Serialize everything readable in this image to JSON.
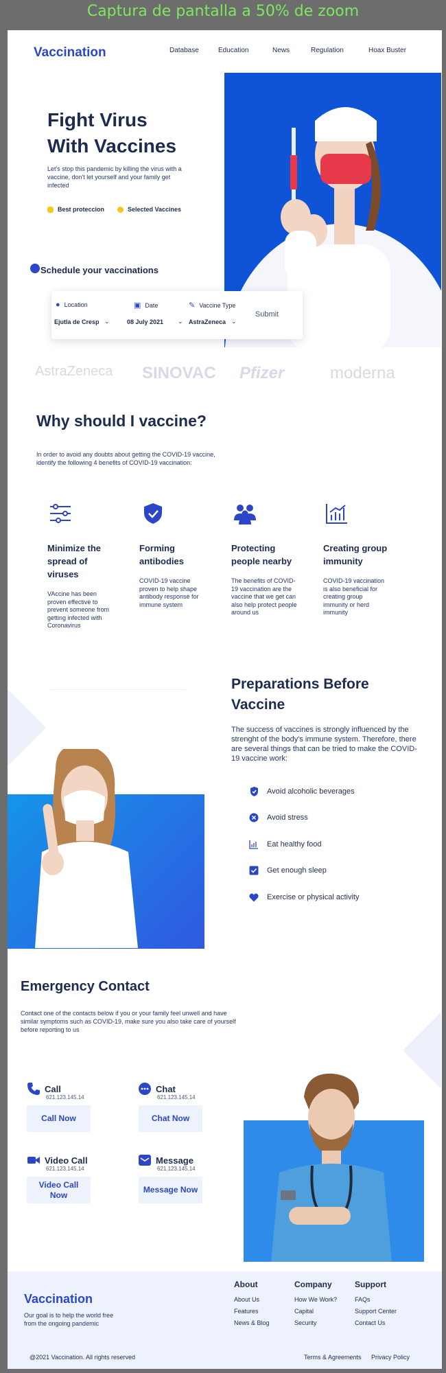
{
  "caption": "Captura de pantalla a 50% de zoom",
  "nav": {
    "logo": "Vaccination",
    "links": [
      "Database",
      "Education",
      "News",
      "Regulation",
      "Hoax Buster"
    ]
  },
  "hero": {
    "title_line1": "Fight Virus",
    "title_line2": "With Vaccines",
    "subtitle": "Let's stop this pandemic by killing the virus with a vaccine, don't let yourself and your family get infected",
    "chips": [
      "Best proteccion",
      "Selected Vaccines"
    ]
  },
  "schedule": {
    "title": "Schedule your vaccinations",
    "location_label": "Location",
    "location_value": "Ejutla de Cresp",
    "date_label": "Date",
    "date_value": "08 July 2021",
    "vaccine_label": "Vaccine Type",
    "vaccine_value": "AstraZeneca",
    "submit": "Submit"
  },
  "brands": [
    "AstraZeneca",
    "SINOVAC",
    "Pfizer",
    "moderna"
  ],
  "why": {
    "title": "Why should I vaccine?",
    "subtitle": "In order to avoid any doubts about getting the COVID-19 vaccine, identify the following 4 benefits of COVID-19 vaccination:",
    "benefits": [
      {
        "title": "Minimize the spread of viruses",
        "desc": "VAccine has been proven effective to prevent someone from getting infected with Coronavirus",
        "icon": "sliders-icon"
      },
      {
        "title": "Forming antibodies",
        "desc": "COVID-19 vaccine proven to help shape antibody response for immune system",
        "icon": "shield-check-icon"
      },
      {
        "title": "Protecting people nearby",
        "desc": "The benefits of COVID-19 vaccination are the vaccine that we get can also help protect people around us",
        "icon": "people-icon"
      },
      {
        "title": "Creating group immunity",
        "desc": "COVID-19 vaccination is also beneficial for creating group immunity or herd immunity",
        "icon": "bar-chart-icon"
      }
    ]
  },
  "prep": {
    "title": "Preparations Before Vaccine",
    "text": "The success of vaccines is strongly influenced by the strenght of the body's immune system. Therefore, there are several things that can be tried to make the COVID-19 vaccine work:",
    "items": [
      "Avoid alcoholic beverages",
      "Avoid stress",
      "Eat healthy food",
      "Get enough sleep",
      "Exercise or physical activity"
    ]
  },
  "emergency": {
    "title": "Emergency Contact",
    "subtitle": "Contact one of the contacts below if you or your family feel unwell and have similar symptoms such as COVID-19, make sure you also take care of yourself before reporting to us",
    "contacts": [
      {
        "name": "Call",
        "number": "621.123.145.14",
        "button": "Call Now",
        "icon": "phone-icon"
      },
      {
        "name": "Chat",
        "number": "621.123.145.14",
        "button": "Chat Now",
        "icon": "chat-icon"
      },
      {
        "name": "Video Call",
        "number": "621.123.145.14",
        "button": "Video Call Now",
        "icon": "video-icon"
      },
      {
        "name": "Message",
        "number": "621.123.145.14",
        "button": "Message Now",
        "icon": "mail-icon"
      }
    ]
  },
  "footer": {
    "logo": "Vaccination",
    "tagline": "Our goal is to help the world free from the ongoing pandemic",
    "columns": [
      {
        "title": "About",
        "links": [
          "About Us",
          "Features",
          "News & Blog"
        ]
      },
      {
        "title": "Company",
        "links": [
          "How We Work?",
          "Capital",
          "Security"
        ]
      },
      {
        "title": "Support",
        "links": [
          "FAQs",
          "Support Center",
          "Contact Us"
        ]
      }
    ],
    "copyright": "@2021 Vaccination. All rights reserved",
    "terms": "Terms & Agreements",
    "privacy": "Privacy Policy"
  },
  "colors": {
    "brand_blue": "#2b47c8",
    "navy": "#1d2b4f",
    "hero_blue": "#0f53d6",
    "accent_yellow": "#f4c81c"
  }
}
